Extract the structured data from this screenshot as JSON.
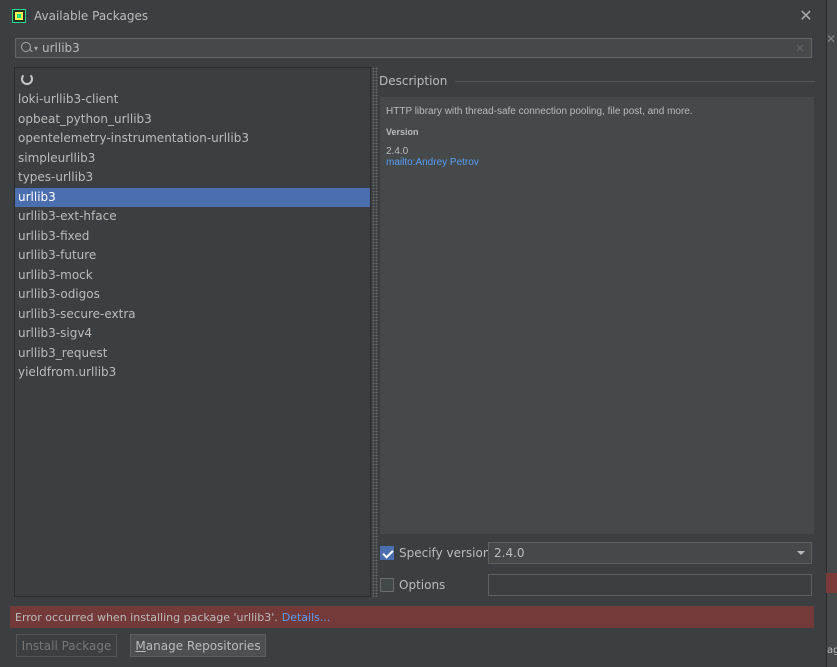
{
  "window": {
    "title": "Available Packages",
    "close_symbol": "✕"
  },
  "search": {
    "value": "urllib3",
    "clear_symbol": "✕"
  },
  "packages": [
    "loki-urllib3-client",
    "opbeat_python_urllib3",
    "opentelemetry-instrumentation-urllib3",
    "simpleurllib3",
    "types-urllib3",
    "urllib3",
    "urllib3-ext-hface",
    "urllib3-fixed",
    "urllib3-future",
    "urllib3-mock",
    "urllib3-odigos",
    "urllib3-secure-extra",
    "urllib3-sigv4",
    "urllib3_request",
    "yieldfrom.urllib3"
  ],
  "selected_package": "urllib3",
  "description": {
    "header": "Description",
    "text": "HTTP library with thread-safe connection pooling, file post, and more.",
    "version_label": "Version",
    "version_value": "2.4.0",
    "author_link": "mailto:Andrey Petrov"
  },
  "options": {
    "specify_version_label": "Specify version",
    "specify_version_checked": true,
    "version_selected": "2.4.0",
    "options_label": "Options",
    "options_checked": false,
    "options_value": ""
  },
  "error": {
    "message": "Error occurred when installing package 'urllib3'.",
    "details_link": "Details..."
  },
  "buttons": {
    "install": "Install Package",
    "manage_repos_first": "M",
    "manage_repos_rest": "anage Repositories"
  },
  "edge": {
    "close_symbol": "✕",
    "partial_text": "ag"
  },
  "colors": {
    "background": "#3c3f41",
    "selection": "#4b6eaf",
    "link": "#589df6",
    "error": "#743a3a"
  }
}
